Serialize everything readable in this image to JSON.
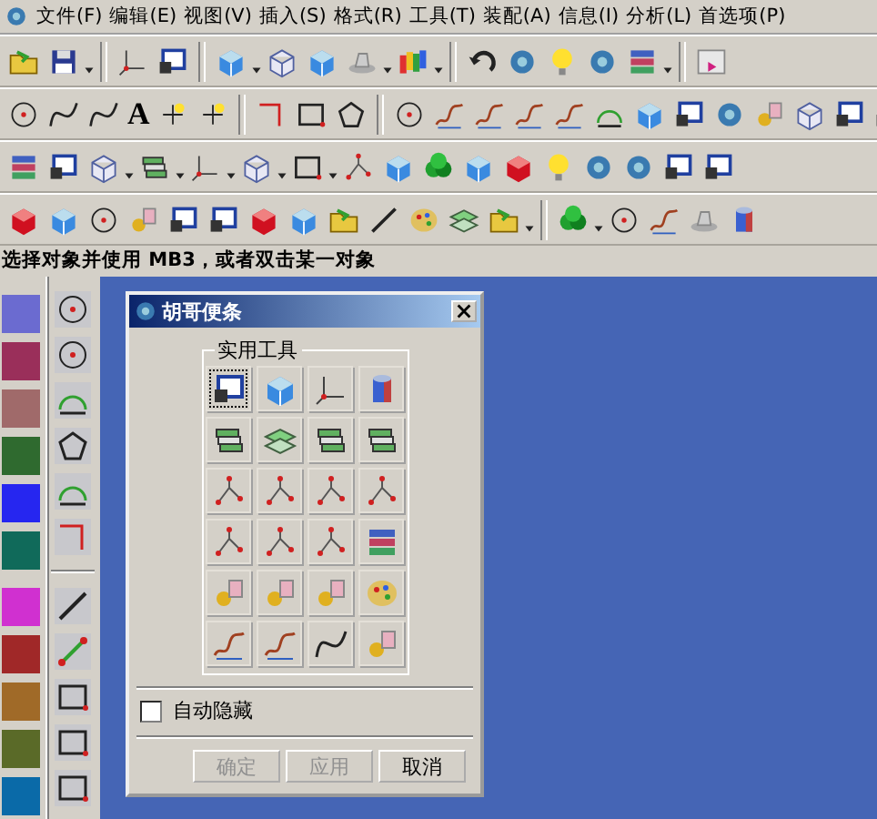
{
  "menu": [
    "文件(F)",
    "编辑(E)",
    "视图(V)",
    "插入(S)",
    "格式(R)",
    "工具(T)",
    "装配(A)",
    "信息(I)",
    "分析(L)",
    "首选项(P)"
  ],
  "drawing_toolbar": {
    "text_tool_label": "A"
  },
  "status_line": "选择对象并使用 MB3，或者双击某一对象",
  "palette": [
    {
      "color": "#6b6bd0"
    },
    {
      "color": "#9a2f5a"
    },
    {
      "color": "#a06a6a"
    },
    {
      "color": "#2f6a2f"
    },
    {
      "color": "#2626f0"
    },
    {
      "color": "#106a5a"
    },
    {
      "color": "#d030d0"
    },
    {
      "color": "#a02828"
    },
    {
      "color": "#a06a28"
    },
    {
      "color": "#5a6a28"
    },
    {
      "color": "#0a6aa8"
    }
  ],
  "dialog": {
    "title": "胡哥便条",
    "group_title": "实用工具",
    "auto_hide": {
      "label": "自动隐藏",
      "checked": false
    },
    "buttons": [
      {
        "label": "确定",
        "disabled": true
      },
      {
        "label": "应用",
        "disabled": true
      },
      {
        "label": "取消",
        "disabled": false
      }
    ]
  }
}
